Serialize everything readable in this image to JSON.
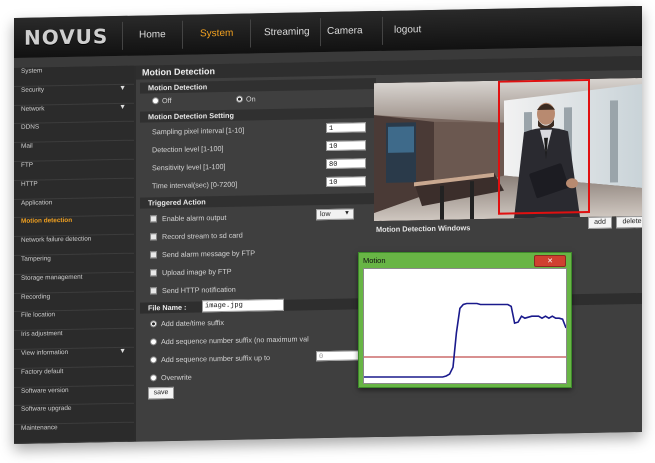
{
  "brand": {
    "logo": "NOVUS"
  },
  "nav": {
    "items": [
      {
        "label": "Home",
        "active": false
      },
      {
        "label": "System",
        "active": true
      },
      {
        "label": "Streaming",
        "active": false
      },
      {
        "label": "Camera",
        "active": false
      },
      {
        "label": "logout",
        "active": false
      }
    ]
  },
  "sidebar": {
    "items": [
      {
        "label": "System",
        "arrow": false,
        "active": false
      },
      {
        "label": "Security",
        "arrow": true,
        "active": false
      },
      {
        "label": "Network",
        "arrow": true,
        "active": false
      },
      {
        "label": "DDNS",
        "arrow": false,
        "active": false
      },
      {
        "label": "Mail",
        "arrow": false,
        "active": false
      },
      {
        "label": "FTP",
        "arrow": false,
        "active": false
      },
      {
        "label": "HTTP",
        "arrow": false,
        "active": false
      },
      {
        "label": "Application",
        "arrow": false,
        "active": false
      },
      {
        "label": "Motion detection",
        "arrow": false,
        "active": true
      },
      {
        "label": "Network failure detection",
        "arrow": false,
        "active": false
      },
      {
        "label": "Tampering",
        "arrow": false,
        "active": false
      },
      {
        "label": "Storage management",
        "arrow": false,
        "active": false
      },
      {
        "label": "Recording",
        "arrow": false,
        "active": false
      },
      {
        "label": "File location",
        "arrow": false,
        "active": false
      },
      {
        "label": "Iris adjustment",
        "arrow": false,
        "active": false
      },
      {
        "label": "View information",
        "arrow": true,
        "active": false
      },
      {
        "label": "Factory default",
        "arrow": false,
        "active": false
      },
      {
        "label": "Software version",
        "arrow": false,
        "active": false
      },
      {
        "label": "Software upgrade",
        "arrow": false,
        "active": false
      },
      {
        "label": "Maintenance",
        "arrow": false,
        "active": false
      }
    ]
  },
  "page": {
    "title": "Motion Detection"
  },
  "md": {
    "header": "Motion Detection",
    "off_label": "Off",
    "on_label": "On",
    "state": "On",
    "settings_header": "Motion Detection Setting",
    "fields": [
      {
        "label": "Sampling pixel interval [1-10]",
        "value": "1"
      },
      {
        "label": "Detection level [1-100]",
        "value": "10"
      },
      {
        "label": "Sensitivity level [1-100]",
        "value": "80"
      },
      {
        "label": "Time interval(sec) [0-7200]",
        "value": "10"
      }
    ]
  },
  "trig": {
    "header": "Triggered Action",
    "items": [
      {
        "label": "Enable alarm output"
      },
      {
        "label": "Record stream to sd card"
      },
      {
        "label": "Send alarm message by FTP"
      },
      {
        "label": "Upload image by FTP"
      },
      {
        "label": "Send HTTP notification"
      }
    ],
    "alarm_level": "low",
    "filename_label": "File Name :",
    "filename_value": "image.jpg",
    "suffix_options": [
      {
        "label": "Add date/time suffix",
        "selected": true
      },
      {
        "label": "Add sequence number suffix (no maximum val",
        "selected": false
      },
      {
        "label": "Add sequence number suffix up to",
        "selected": false
      },
      {
        "label": "Overwrite",
        "selected": false
      }
    ],
    "suffix_max": "0",
    "save_label": "save"
  },
  "detection": {
    "windows_label": "Motion Detection Windows",
    "add_label": "add",
    "delete_label": "delete",
    "box_color": "#e01010"
  },
  "motion_window": {
    "title": "Motion",
    "close_icon": "close-icon",
    "threshold_color": "#b02020",
    "line_color": "#1a1a8c",
    "trace": [
      0,
      0,
      0,
      0,
      0,
      0,
      0,
      0,
      0,
      0,
      0,
      0,
      0,
      0,
      0,
      0,
      0,
      0,
      0,
      0,
      0,
      0,
      0,
      0,
      0.01,
      0.03,
      0.1,
      0.45,
      0.7,
      0.74,
      0.75,
      0.75,
      0.75,
      0.75,
      0.74,
      0.74,
      0.74,
      0.74,
      0.74,
      0.74,
      0.74,
      0.74,
      0.74,
      0.72,
      0.55,
      0.56,
      0.62,
      0.6,
      0.61,
      0.62,
      0.62,
      0.62,
      0.6,
      0.62,
      0.6,
      0.62,
      0.6,
      0.6,
      0.59,
      0.5
    ]
  },
  "colors": {
    "accent": "#f0a020"
  }
}
